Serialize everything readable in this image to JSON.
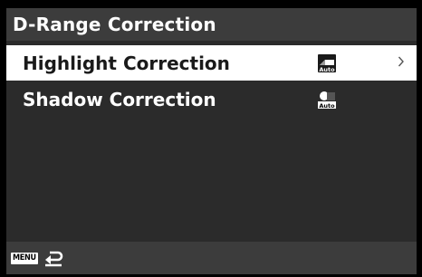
{
  "screen": {
    "title": "D-Range Correction"
  },
  "menu": {
    "items": [
      {
        "label": "Highlight Correction",
        "value_icon": "highlight-correction-auto-icon",
        "value_text": "Auto",
        "selected": true,
        "has_submenu": true
      },
      {
        "label": "Shadow Correction",
        "value_icon": "shadow-correction-auto-icon",
        "value_text": "Auto",
        "selected": false,
        "has_submenu": false
      }
    ]
  },
  "footer": {
    "menu_button_label": "MENU",
    "back_icon": "return-arrow-icon"
  },
  "colors": {
    "background": "#000000",
    "panel": "#2b2b2b",
    "title_bar": "#3c3c3c",
    "selected_row": "#ffffff",
    "text_light": "#ffffff",
    "text_dark": "#1a1a1a"
  }
}
